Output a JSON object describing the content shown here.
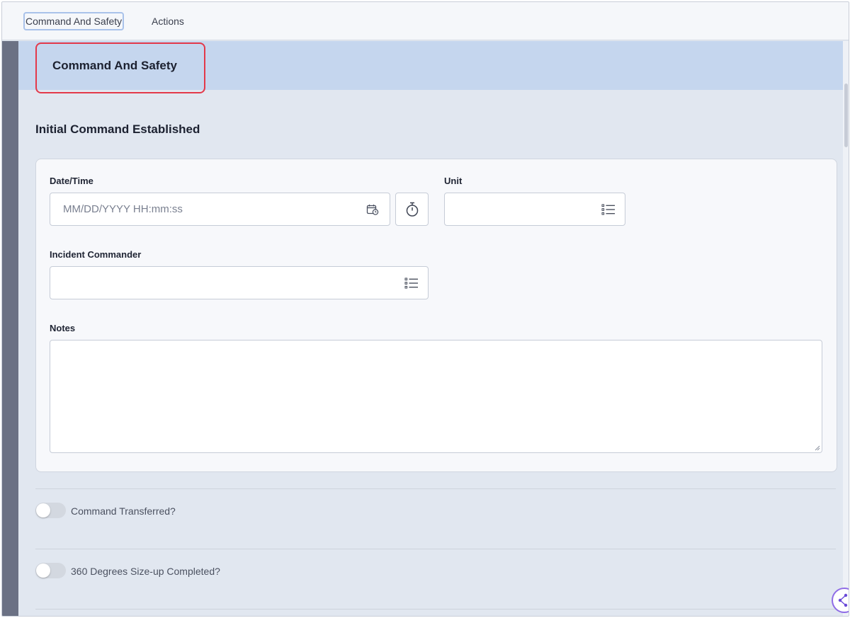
{
  "tabs": [
    {
      "label": "Command And Safety"
    },
    {
      "label": "Actions"
    }
  ],
  "section": {
    "title": "Command And Safety",
    "subheading": "Initial Command Established"
  },
  "form": {
    "datetime": {
      "label": "Date/Time",
      "placeholder": "MM/DD/YYYY HH:mm:ss",
      "value": ""
    },
    "unit": {
      "label": "Unit",
      "value": ""
    },
    "incident_commander": {
      "label": "Incident Commander",
      "value": ""
    },
    "notes": {
      "label": "Notes",
      "value": ""
    }
  },
  "toggles": [
    {
      "label": "Command Transferred?",
      "checked": false
    },
    {
      "label": "360 Degrees Size-up Completed?",
      "checked": false
    }
  ],
  "icons": {
    "datetime_picker": "calendar-clock-icon",
    "timer": "stopwatch-icon",
    "unit_list": "list-icon",
    "commander_list": "list-icon",
    "fab": "workflow-icon"
  },
  "colors": {
    "header_band": "#c5d6ee",
    "highlight_border": "#e3394a",
    "rail": "#6b7184",
    "page_bg": "#e1e7f0",
    "card_bg": "#f7f8fb"
  }
}
